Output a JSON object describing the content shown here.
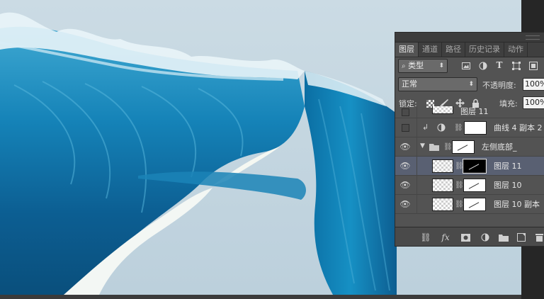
{
  "canvas": {
    "description_icon": "ocean-wave-artwork"
  },
  "panel": {
    "tabs": [
      {
        "label": "图层",
        "active": true
      },
      {
        "label": "通道",
        "active": false
      },
      {
        "label": "路径",
        "active": false
      },
      {
        "label": "历史记录",
        "active": false
      },
      {
        "label": "动作",
        "active": false
      }
    ],
    "filter": {
      "kind_label": "类型",
      "icons": [
        "image-filter-icon",
        "adjust-filter-icon",
        "type-filter-icon",
        "shape-filter-icon",
        "smart-object-filter-icon"
      ]
    },
    "blend_mode": "正常",
    "opacity_label": "不透明度:",
    "opacity_value": "100%",
    "lock_label": "锁定:",
    "fill_label": "填充:",
    "fill_value": "100%",
    "layers": [
      {
        "name": "图层 11",
        "partial": true,
        "visible": false
      },
      {
        "name": "曲线 4 副本 2",
        "visible": false
      },
      {
        "name": "左侧底部_",
        "visible": true,
        "group": true
      },
      {
        "name": "图层 11",
        "visible": true,
        "selected": true
      },
      {
        "name": "图层 10",
        "visible": true
      },
      {
        "name": "图层 10 副本",
        "visible": true
      }
    ],
    "bottom_icons": [
      "link-layers-icon",
      "fx-icon",
      "add-mask-icon",
      "adjustment-layer-icon",
      "new-group-icon",
      "new-layer-icon",
      "delete-layer-icon"
    ],
    "fx_label": "fx"
  },
  "colors": {
    "panel_bg": "#535353",
    "selected_row": "#596072",
    "canvas_bg": "#c2d5df"
  }
}
